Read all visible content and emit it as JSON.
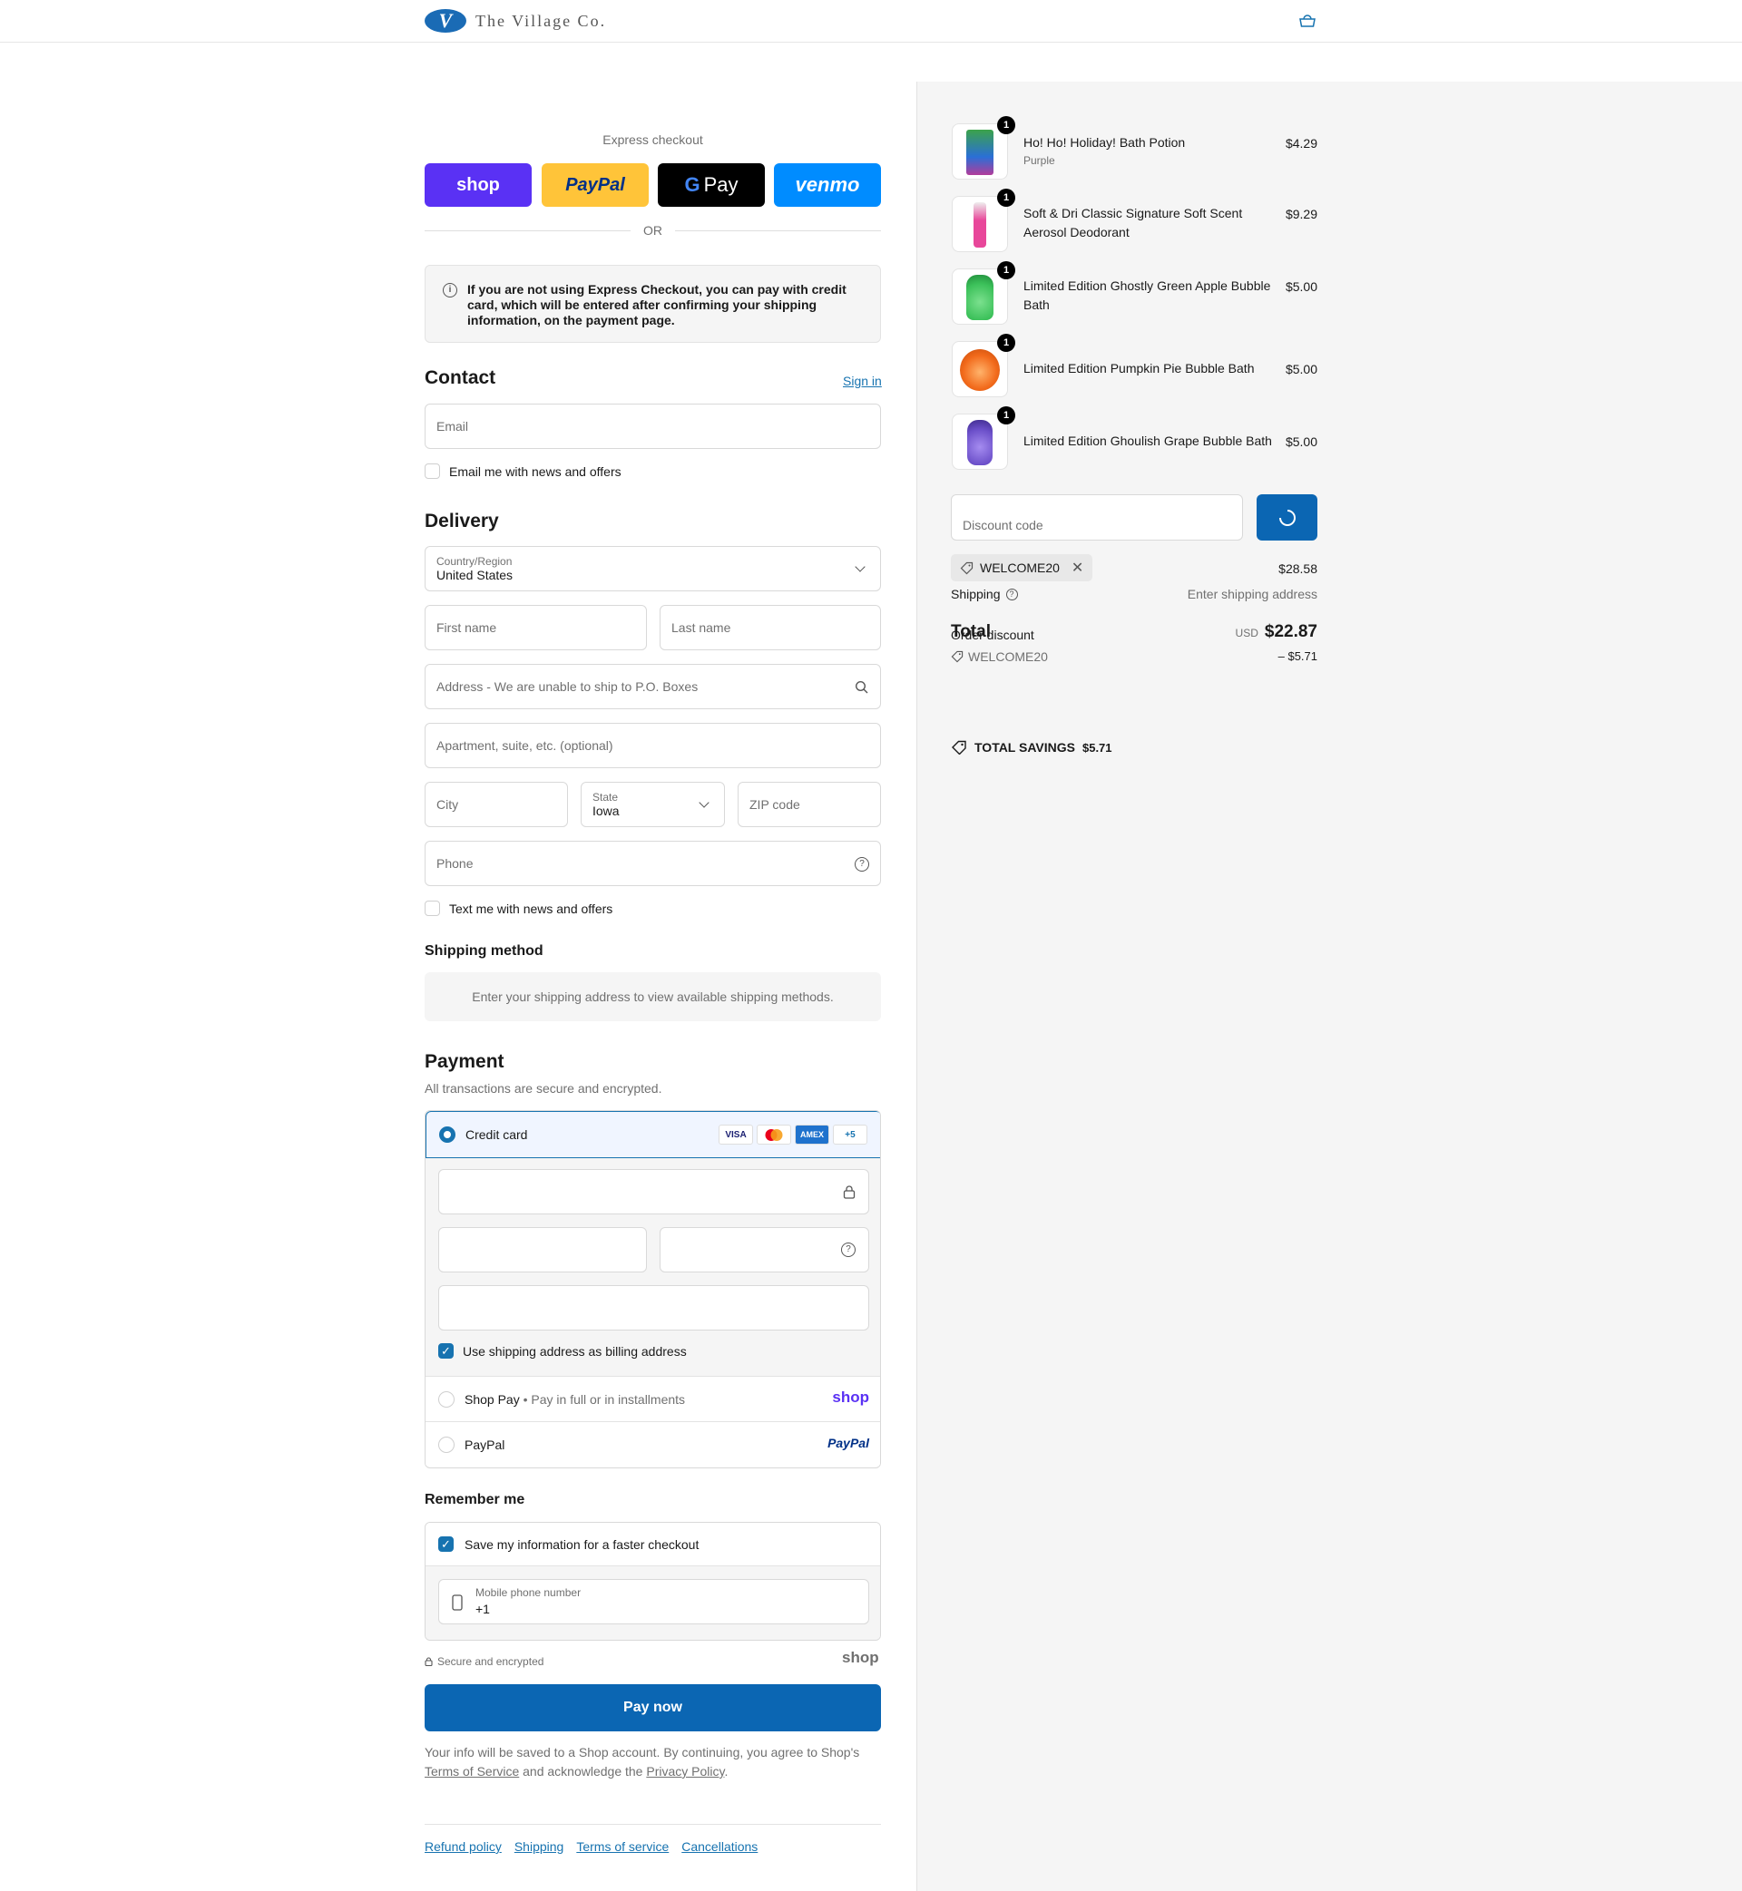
{
  "brand": {
    "logo_letter": "V",
    "name": "The Village Co."
  },
  "express": {
    "label": "Express checkout",
    "buttons": {
      "shop": "shop",
      "paypal": "PayPal",
      "gpay": "Pay",
      "venmo": "venmo"
    },
    "or": "OR"
  },
  "notice": "If you are not using Express Checkout, you can pay with credit card, which will be entered after confirming your shipping information, on the payment page.",
  "contact": {
    "title": "Contact",
    "signin": "Sign in",
    "email_placeholder": "Email",
    "news_label": "Email me with news and offers"
  },
  "delivery": {
    "title": "Delivery",
    "country_label": "Country/Region",
    "country_value": "United States",
    "first_name": "First name",
    "last_name": "Last name",
    "address": "Address - We are unable to ship to P.O. Boxes",
    "apartment": "Apartment, suite, etc. (optional)",
    "city": "City",
    "state_label": "State",
    "state_value": "Iowa",
    "zip": "ZIP code",
    "phone": "Phone",
    "text_label": "Text me with news and offers"
  },
  "shipping_method": {
    "title": "Shipping method",
    "info": "Enter your shipping address to view available shipping methods."
  },
  "payment": {
    "title": "Payment",
    "subtitle": "All transactions are secure and encrypted.",
    "credit_card": "Credit card",
    "badges": {
      "visa": "VISA",
      "amex": "AMEX",
      "more": "+5"
    },
    "billing_label": "Use shipping address as billing address",
    "shop_pay": "Shop Pay",
    "shop_pay_sub": "Pay in full or in installments",
    "shop_logo": "shop",
    "paypal": "PayPal",
    "paypal_logo": "PayPal"
  },
  "remember": {
    "title": "Remember me",
    "save_label": "Save my information for a faster checkout",
    "mobile_label": "Mobile phone number",
    "mobile_value": "+1",
    "secure": "Secure and encrypted",
    "shop_logo": "shop"
  },
  "pay_now": "Pay now",
  "legal": {
    "part1": "Your info will be saved to a Shop account. By continuing, you agree to Shop's",
    "tos": "Terms of Service",
    "part2": "and acknowledge the",
    "privacy": "Privacy Policy",
    "end": "."
  },
  "footer": [
    "Refund policy",
    "Shipping",
    "Terms of service",
    "Cancellations"
  ],
  "cart": {
    "items": [
      {
        "name": "Ho! Ho! Holiday! Bath Potion",
        "variant": "Purple",
        "price": "$4.29",
        "qty": "1",
        "color": "#2a6fd6"
      },
      {
        "name": "Soft & Dri Classic Signature Soft Scent Aerosol Deodorant",
        "variant": "",
        "price": "$9.29",
        "qty": "1",
        "color": "#e8479a"
      },
      {
        "name": "Limited Edition Ghostly Green Apple Bubble Bath",
        "variant": "",
        "price": "$5.00",
        "qty": "1",
        "color": "#3cc15a"
      },
      {
        "name": "Limited Edition Pumpkin Pie Bubble Bath",
        "variant": "",
        "price": "$5.00",
        "qty": "1",
        "color": "#f26a1b"
      },
      {
        "name": "Limited Edition Ghoulish Grape Bubble Bath",
        "variant": "",
        "price": "$5.00",
        "qty": "1",
        "color": "#6b4fc9"
      }
    ],
    "discount_placeholder": "Discount code",
    "applied_code": "WELCOME20",
    "subtotal": "$28.58",
    "shipping_label": "Shipping",
    "shipping_value": "Enter shipping address",
    "order_discount_label": "Order discount",
    "total_label": "Total",
    "currency": "USD",
    "total": "$22.87",
    "discount_code": "WELCOME20",
    "discount_amount": "– $5.71",
    "savings_label": "TOTAL SAVINGS",
    "savings_value": "$5.71"
  }
}
